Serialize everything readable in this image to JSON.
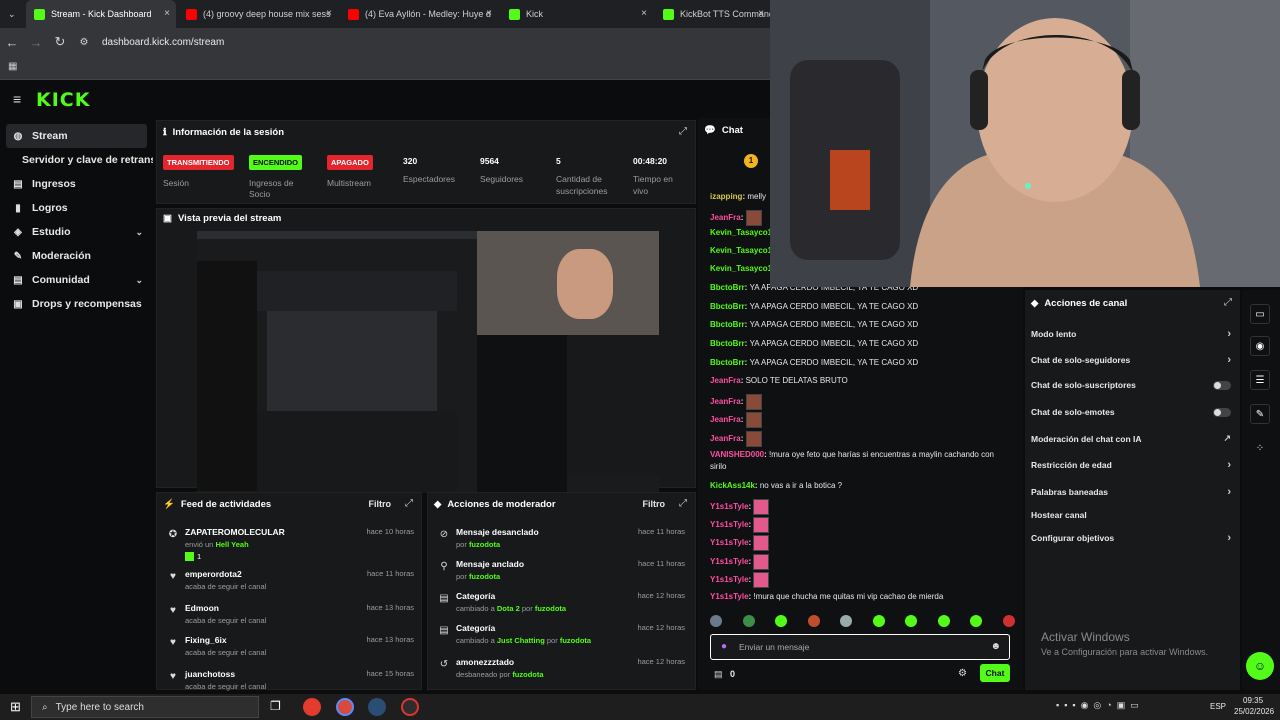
{
  "browser": {
    "tabs": [
      {
        "label": "Stream - Kick Dashboard",
        "icon": "kick",
        "active": true
      },
      {
        "label": "(4) groovy deep house mix sess",
        "icon": "youtube"
      },
      {
        "label": "(4) Eva Ayllón - Medley: Huye d",
        "icon": "youtube"
      },
      {
        "label": "Kick",
        "icon": "kick"
      },
      {
        "label": "KickBot TTS Commands",
        "icon": "kick"
      }
    ],
    "url": "dashboard.kick.com/stream"
  },
  "logo": "KICK",
  "sidebar": {
    "items": [
      {
        "label": "Stream",
        "icon": "stream-icon",
        "active": true
      },
      {
        "label": "Servidor y clave de retransmisión",
        "sub": true
      },
      {
        "label": "Ingresos",
        "icon": "money-icon"
      },
      {
        "label": "Logros",
        "icon": "trophy-icon"
      },
      {
        "label": "Estudio",
        "icon": "studio-icon",
        "chevron": true
      },
      {
        "label": "Moderación",
        "icon": "wrench-icon"
      },
      {
        "label": "Comunidad",
        "icon": "community-icon",
        "chevron": true
      },
      {
        "label": "Drops y recompensas",
        "icon": "gift-icon"
      }
    ]
  },
  "session": {
    "title": "Información de la sesión",
    "status_label": "TRANSMITIENDO",
    "status_caption": "Sesión",
    "ingresos_badge": "ENCENDIDO",
    "ingresos_caption": "Ingresos de Socio",
    "multistream_badge": "APAGADO",
    "multistream_caption": "Multistream",
    "viewers": "320",
    "viewers_label": "Espectadores",
    "followers": "9564",
    "followers_label": "Seguidores",
    "subs": "5",
    "subs_label": "Cantidad de suscripciones",
    "time": "00:48:20",
    "time_label": "Tiempo en vivo"
  },
  "preview": {
    "title": "Vista previa del stream"
  },
  "feed": {
    "title": "Feed de actividades",
    "filter": "Filtro",
    "rows": [
      {
        "name": "ZAPATEROMOLECULAR",
        "sub": "envió un",
        "extra": "Hell Yeah",
        "count": "1",
        "time": "hace 10 horas",
        "icon": "gift-icon"
      },
      {
        "name": "emperordota2",
        "sub": "acaba de seguir el canal",
        "time": "hace 11 horas",
        "icon": "heart-icon"
      },
      {
        "name": "Edmoon",
        "sub": "acaba de seguir el canal",
        "time": "hace 13 horas",
        "icon": "heart-icon"
      },
      {
        "name": "Fixing_6ix",
        "sub": "acaba de seguir el canal",
        "time": "hace 13 horas",
        "icon": "heart-icon"
      },
      {
        "name": "juanchotoss",
        "sub": "acaba de seguir el canal",
        "time": "hace 15 horas",
        "icon": "heart-icon"
      }
    ]
  },
  "modactions": {
    "title": "Acciones de moderador",
    "filter": "Filtro",
    "rows": [
      {
        "name": "Mensaje desanclado",
        "sub": "por",
        "by": "fuzodota",
        "time": "hace 11 horas",
        "icon": "unpin-icon"
      },
      {
        "name": "Mensaje anclado",
        "sub": "por",
        "by": "fuzodota",
        "time": "hace 11 horas",
        "icon": "pin-icon"
      },
      {
        "name": "Categoría",
        "sub": "cambiado a",
        "cat": "Dota 2",
        "sub2": "por",
        "by": "fuzodota",
        "time": "hace 12 horas",
        "icon": "category-icon"
      },
      {
        "name": "Categoría",
        "sub": "cambiado a",
        "cat": "Just Chatting",
        "sub2": "por",
        "by": "fuzodota",
        "time": "hace 12 horas",
        "icon": "category-icon"
      },
      {
        "name": "amonezzztado",
        "sub": "desbaneado por",
        "by": "fuzodota",
        "time": "hace 12 horas",
        "icon": "unban-icon"
      }
    ]
  },
  "chat": {
    "title": "Chat",
    "messages": [
      {
        "user": "izapping",
        "text": "melly",
        "cls": "user-y"
      },
      {
        "user": "JeanFra",
        "emote": true,
        "cls": "user-p"
      },
      {
        "user": "Kevin_Tasayco1",
        "text": "",
        "cls": "user-g"
      },
      {
        "user": "Kevin_Tasayco1",
        "text": "",
        "cls": "user-g"
      },
      {
        "user": "Kevin_Tasayco1",
        "text": "",
        "cls": "user-g"
      },
      {
        "user": "BbctoBrr",
        "text": "YA APAGA CERDO IMBECIL, YA TE CAGO XD",
        "cls": "user-g"
      },
      {
        "user": "BbctoBrr",
        "text": "YA APAGA CERDO IMBECIL, YA TE CAGO XD",
        "cls": "user-g"
      },
      {
        "user": "BbctoBrr",
        "text": "YA APAGA CERDO IMBECIL, YA TE CAGO XD",
        "cls": "user-g"
      },
      {
        "user": "BbctoBrr",
        "text": "YA APAGA CERDO IMBECIL, YA TE CAGO XD",
        "cls": "user-g"
      },
      {
        "user": "BbctoBrr",
        "text": "YA APAGA CERDO IMBECIL, YA TE CAGO XD",
        "cls": "user-g"
      },
      {
        "user": "JeanFra",
        "text": "SOLO TE DELATAS BRUTO",
        "cls": "user-p"
      },
      {
        "user": "JeanFra",
        "emote": true,
        "cls": "user-p"
      },
      {
        "user": "JeanFra",
        "emote": true,
        "cls": "user-p"
      },
      {
        "user": "JeanFra",
        "emote": true,
        "cls": "user-p"
      },
      {
        "user": "VANISHED000",
        "text": "!mura oye feto que harías si encuentras a maylin cachando con",
        "cls": "user-p"
      },
      {
        "user": "",
        "text": "sirilo",
        "cls": "user-p"
      },
      {
        "user": "KickAss14k",
        "text": "no vas a ir a la botica ?",
        "cls": "user-g"
      },
      {
        "user": "Y1s1sTyle",
        "emote": true,
        "pink": true,
        "cls": "user-p"
      },
      {
        "user": "Y1s1sTyle",
        "emote": true,
        "pink": true,
        "cls": "user-p"
      },
      {
        "user": "Y1s1sTyle",
        "emote": true,
        "pink": true,
        "cls": "user-p"
      },
      {
        "user": "Y1s1sTyle",
        "emote": true,
        "pink": true,
        "cls": "user-p"
      },
      {
        "user": "Y1s1sTyle",
        "emote": true,
        "pink": true,
        "cls": "user-p"
      },
      {
        "user": "Y1s1sTyle",
        "text": "!mura que chucha me quitas mi vip cachao de mierda",
        "cls": "user-p"
      }
    ],
    "input_placeholder": "Enviar un mensaje",
    "send_label": "Chat",
    "kicks": "0"
  },
  "actions": {
    "title": "Acciones de canal",
    "items": [
      {
        "label": "Modo lento",
        "type": "arrow"
      },
      {
        "label": "Chat de solo-seguidores",
        "type": "arrow"
      },
      {
        "label": "Chat de solo-suscriptores",
        "type": "toggle"
      },
      {
        "label": "Chat de solo-emotes",
        "type": "toggle"
      },
      {
        "label": "Moderación del chat con IA",
        "type": "external"
      },
      {
        "label": "Restricción de edad",
        "type": "arrow"
      },
      {
        "label": "Palabras baneadas",
        "type": "arrow"
      },
      {
        "label": "Hostear canal",
        "type": "none"
      },
      {
        "label": "Configurar objetivos",
        "type": "arrow"
      }
    ]
  },
  "windows": {
    "activate_title": "Activar Windows",
    "activate_sub": "Ve a Configuración para activar Windows.",
    "search_placeholder": "Type here to search",
    "time": "09:35",
    "date": "25/02/2026",
    "lang": "ESP"
  }
}
